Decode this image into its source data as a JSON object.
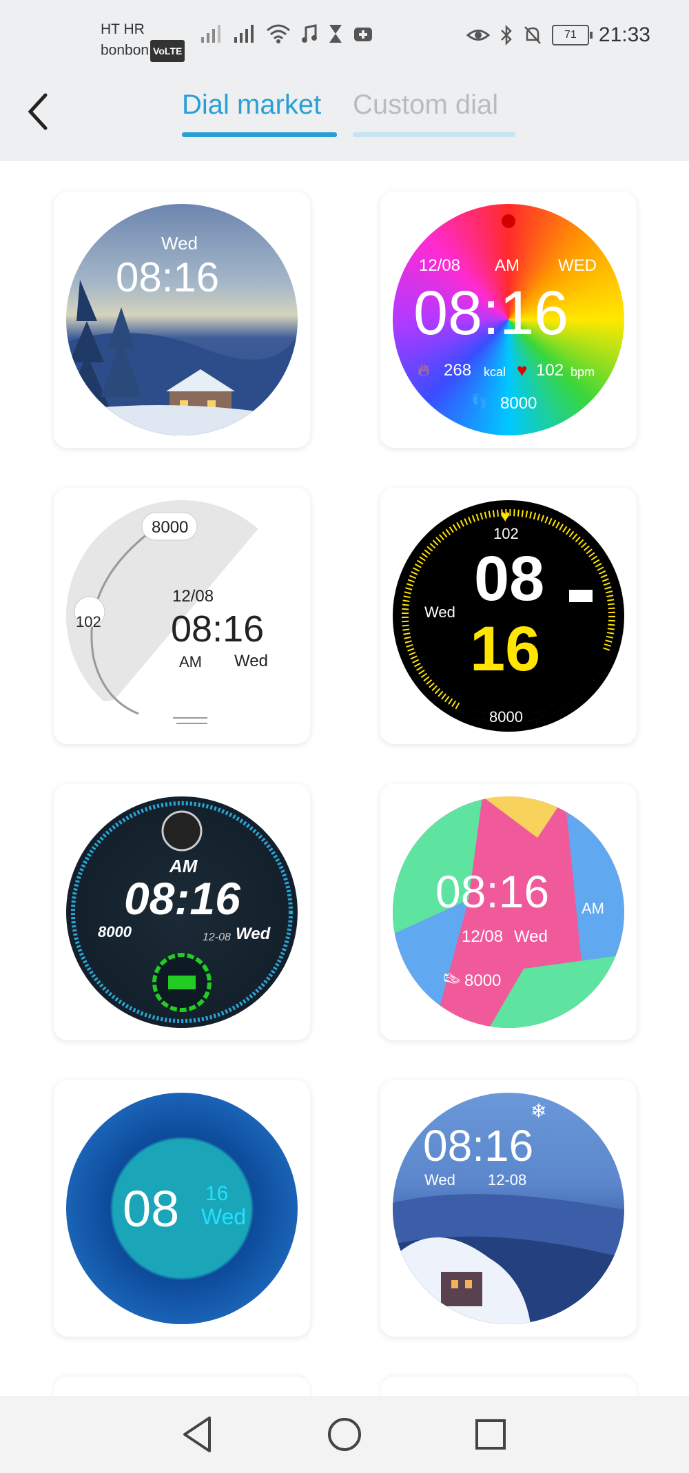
{
  "status_bar": {
    "carrier_line1": "HT HR",
    "carrier_line2": "bonbon",
    "volte": "VoLTE",
    "battery": "71",
    "time": "21:33"
  },
  "header": {
    "tabs": [
      {
        "label": "Dial market",
        "active": true
      },
      {
        "label": "Custom dial",
        "active": false
      }
    ]
  },
  "dials": [
    {
      "day": "Wed",
      "time": "08:16"
    },
    {
      "date": "12/08",
      "ampm": "AM",
      "day": "WED",
      "time": "08:16",
      "kcal": "268",
      "kcal_unit": "kcal",
      "bpm": "102",
      "bpm_unit": "bpm",
      "steps": "8000"
    },
    {
      "steps": "8000",
      "heart": "102",
      "date": "12/08",
      "time": "08:16",
      "ampm": "AM",
      "day": "Wed"
    },
    {
      "heart": "102",
      "hour": "08",
      "minute": "16",
      "day": "Wed",
      "steps": "8000"
    },
    {
      "ampm": "AM",
      "time": "08:16",
      "steps": "8000",
      "date": "12-08",
      "day": "Wed"
    },
    {
      "time": "08:16",
      "ampm": "AM",
      "date": "12/08",
      "day": "Wed",
      "steps": "8000"
    },
    {
      "hour": "08",
      "minute": "16",
      "day": "Wed"
    },
    {
      "time": "08:16",
      "day": "Wed",
      "date": "12-08"
    }
  ],
  "colors": {
    "accent": "#2a9fd6",
    "inactive_tab": "#b8bcc2",
    "header_bg": "#eeeff1"
  }
}
